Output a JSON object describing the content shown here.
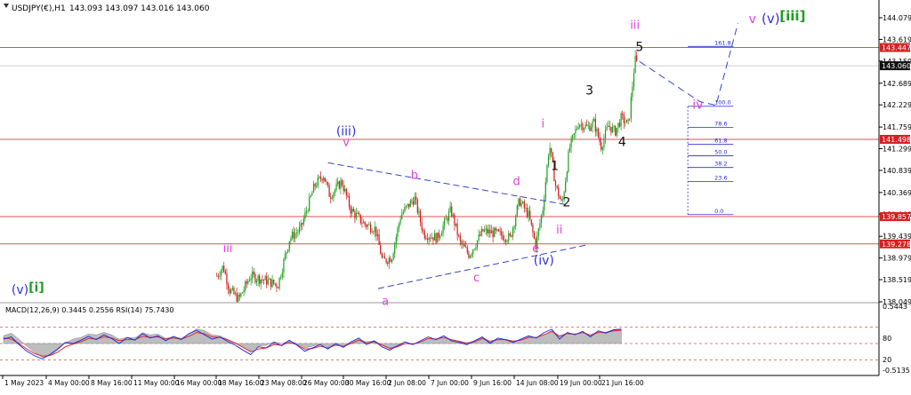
{
  "header": {
    "symbol": "USDJPY(€),H1",
    "ohlc": "143.093 143.097 143.016 143.060"
  },
  "colors": {
    "candle_up": "#1a9e1a",
    "candle_down": "#d01818",
    "level_line": "#e05050",
    "wave_magenta": "#e040e0",
    "wave_blue": "#3030e0",
    "wave_green": "#1f9f1f",
    "wave_black": "#111111",
    "trend_line": "#3344cc",
    "fib": "#2a2ad0",
    "price_tag": "#d62020",
    "current_tag": "#111111",
    "macd_hist": "#bdbdbd",
    "macd_signal": "#e03030",
    "rsi": "#2020e0",
    "indicator_level": "#e05050"
  },
  "chart_data": {
    "type": "candlestick",
    "y_axis_ticks": [
      "144.079",
      "143.619",
      "143.159",
      "142.689",
      "142.229",
      "141.759",
      "141.299",
      "140.839",
      "140.369",
      "139.909",
      "139.439",
      "138.979",
      "138.519",
      "138.049"
    ],
    "ylim": [
      138.049,
      144.079
    ],
    "x_axis_ticks": [
      "1 May 2023",
      "4 May 00:00",
      "8 May 16:00",
      "11 May 00:00",
      "16 May 00:00",
      "18 May 16:00",
      "23 May 08:00",
      "26 May 00:00",
      "30 May 16:00",
      "2 Jun 08:00",
      "7 Jun 00:00",
      "9 Jun 16:00",
      "14 Jun 08:00",
      "19 Jun 00:00",
      "21 Jun 16:00"
    ],
    "current_price": "143.060",
    "price_levels": [
      {
        "label": "143.447",
        "value": 143.447
      },
      {
        "label": "141.498",
        "value": 141.498
      },
      {
        "label": "139.857",
        "value": 139.857
      },
      {
        "label": "139.278",
        "value": 139.278
      }
    ],
    "price_path": [
      {
        "x": 0.238,
        "y": 138.6
      },
      {
        "x": 0.245,
        "y": 138.8
      },
      {
        "x": 0.252,
        "y": 138.3
      },
      {
        "x": 0.262,
        "y": 138.1
      },
      {
        "x": 0.275,
        "y": 138.6
      },
      {
        "x": 0.292,
        "y": 138.5
      },
      {
        "x": 0.305,
        "y": 138.4
      },
      {
        "x": 0.318,
        "y": 139.4
      },
      {
        "x": 0.33,
        "y": 139.6
      },
      {
        "x": 0.345,
        "y": 140.5
      },
      {
        "x": 0.355,
        "y": 140.75
      },
      {
        "x": 0.362,
        "y": 140.3
      },
      {
        "x": 0.375,
        "y": 140.6
      },
      {
        "x": 0.385,
        "y": 140.0
      },
      {
        "x": 0.4,
        "y": 139.7
      },
      {
        "x": 0.412,
        "y": 139.6
      },
      {
        "x": 0.42,
        "y": 138.9
      },
      {
        "x": 0.43,
        "y": 139.0
      },
      {
        "x": 0.44,
        "y": 139.9
      },
      {
        "x": 0.455,
        "y": 140.25
      },
      {
        "x": 0.465,
        "y": 139.5
      },
      {
        "x": 0.48,
        "y": 139.4
      },
      {
        "x": 0.495,
        "y": 140.0
      },
      {
        "x": 0.505,
        "y": 139.3
      },
      {
        "x": 0.515,
        "y": 139.05
      },
      {
        "x": 0.53,
        "y": 139.55
      },
      {
        "x": 0.545,
        "y": 139.5
      },
      {
        "x": 0.56,
        "y": 139.4
      },
      {
        "x": 0.57,
        "y": 140.2
      },
      {
        "x": 0.58,
        "y": 139.9
      },
      {
        "x": 0.588,
        "y": 139.25
      },
      {
        "x": 0.596,
        "y": 140.05
      },
      {
        "x": 0.603,
        "y": 141.4
      },
      {
        "x": 0.61,
        "y": 140.5
      },
      {
        "x": 0.617,
        "y": 140.1
      },
      {
        "x": 0.625,
        "y": 141.3
      },
      {
        "x": 0.635,
        "y": 141.85
      },
      {
        "x": 0.645,
        "y": 141.75
      },
      {
        "x": 0.652,
        "y": 141.85
      },
      {
        "x": 0.66,
        "y": 141.35
      },
      {
        "x": 0.668,
        "y": 141.8
      },
      {
        "x": 0.675,
        "y": 141.65
      },
      {
        "x": 0.682,
        "y": 141.95
      },
      {
        "x": 0.69,
        "y": 141.8
      },
      {
        "x": 0.697,
        "y": 143.2
      },
      {
        "x": 0.7,
        "y": 143.06
      }
    ],
    "wave_labels": [
      {
        "text": "(v)",
        "x": 0.022,
        "y": 138.22,
        "color": "wave_blue",
        "size": 14
      },
      {
        "text": "[i]",
        "x": 0.04,
        "y": 138.27,
        "color": "wave_green",
        "size": 14,
        "weight": "bold"
      },
      {
        "text": "iii",
        "x": 0.25,
        "y": 139.1,
        "color": "wave_magenta",
        "size": 13
      },
      {
        "text": "(iii)",
        "x": 0.38,
        "y": 141.58,
        "color": "wave_blue",
        "size": 14
      },
      {
        "text": "v",
        "x": 0.38,
        "y": 141.36,
        "color": "wave_magenta",
        "size": 13
      },
      {
        "text": "a",
        "x": 0.423,
        "y": 137.98,
        "color": "wave_magenta",
        "size": 13
      },
      {
        "text": "b",
        "x": 0.455,
        "y": 140.66,
        "color": "wave_magenta",
        "size": 13
      },
      {
        "text": "c",
        "x": 0.523,
        "y": 138.48,
        "color": "wave_magenta",
        "size": 13
      },
      {
        "text": "d",
        "x": 0.567,
        "y": 140.53,
        "color": "wave_magenta",
        "size": 13
      },
      {
        "text": "e",
        "x": 0.588,
        "y": 139.1,
        "color": "wave_magenta",
        "size": 13
      },
      {
        "text": "(iv)",
        "x": 0.597,
        "y": 138.84,
        "color": "wave_blue",
        "size": 14
      },
      {
        "text": "ii",
        "x": 0.614,
        "y": 139.5,
        "color": "wave_magenta",
        "size": 13
      },
      {
        "text": "i",
        "x": 0.596,
        "y": 141.75,
        "color": "wave_magenta",
        "size": 13
      },
      {
        "text": "1",
        "x": 0.609,
        "y": 140.85,
        "color": "wave_black",
        "size": 14
      },
      {
        "text": "2",
        "x": 0.622,
        "y": 140.07,
        "color": "wave_black",
        "size": 14
      },
      {
        "text": "3",
        "x": 0.647,
        "y": 142.45,
        "color": "wave_black",
        "size": 14
      },
      {
        "text": "4",
        "x": 0.683,
        "y": 141.36,
        "color": "wave_black",
        "size": 14
      },
      {
        "text": "5",
        "x": 0.702,
        "y": 143.37,
        "color": "wave_black",
        "size": 14
      },
      {
        "text": "iii",
        "x": 0.697,
        "y": 143.84,
        "color": "wave_magenta",
        "size": 13
      },
      {
        "text": "iv",
        "x": 0.766,
        "y": 142.15,
        "color": "wave_magenta",
        "size": 14
      },
      {
        "text": "v",
        "x": 0.826,
        "y": 143.97,
        "color": "wave_magenta",
        "size": 14
      },
      {
        "text": "(v)",
        "x": 0.846,
        "y": 143.97,
        "color": "wave_blue",
        "size": 15
      },
      {
        "text": "[iii]",
        "x": 0.87,
        "y": 144.02,
        "color": "wave_green",
        "size": 15,
        "weight": "bold"
      }
    ],
    "trend_lines": [
      {
        "x1": 0.36,
        "y1": 141.0,
        "x2": 0.625,
        "y2": 140.1
      },
      {
        "x1": 0.415,
        "y1": 138.33,
        "x2": 0.645,
        "y2": 139.26
      }
    ],
    "projection_path": [
      {
        "x": 0.702,
        "y": 143.15
      },
      {
        "x": 0.768,
        "y": 142.3
      },
      {
        "x": 0.786,
        "y": 142.22
      },
      {
        "x": 0.81,
        "y": 143.96
      }
    ],
    "fibonacci": {
      "x_left": 0.755,
      "x_right": 0.805,
      "levels": [
        {
          "label": "161.8",
          "value": 143.47
        },
        {
          "label": "100.0",
          "value": 142.2
        },
        {
          "label": "78.6",
          "value": 141.75
        },
        {
          "label": "61.8",
          "value": 141.39
        },
        {
          "label": "50.0",
          "value": 141.15
        },
        {
          "label": "38.2",
          "value": 140.9
        },
        {
          "label": "23.6",
          "value": 140.6
        },
        {
          "label": "0.0",
          "value": 139.9
        }
      ]
    },
    "indicator": {
      "title": "MACD(12,26,9) 0.3445 0.2556 RSI(14) 75.7430",
      "y_ticks": [
        "0.5443",
        "80",
        "20",
        "-0.5135"
      ],
      "levels": [
        80,
        50,
        20
      ],
      "rsi": [
        58,
        62,
        48,
        36,
        28,
        22,
        30,
        40,
        52,
        50,
        56,
        63,
        57,
        66,
        59,
        50,
        61,
        56,
        68,
        60,
        64,
        55,
        63,
        57,
        68,
        74,
        66,
        58,
        62,
        54,
        47,
        38,
        30,
        44,
        42,
        52,
        46,
        56,
        47,
        36,
        42,
        48,
        40,
        50,
        43,
        53,
        60,
        48,
        55,
        44,
        38,
        46,
        53,
        48,
        55,
        62,
        57,
        64,
        55,
        52,
        48,
        55,
        62,
        50,
        60,
        57,
        52,
        58,
        64,
        60,
        70,
        76,
        58,
        70,
        66,
        72,
        62,
        73,
        69,
        75,
        76
      ],
      "signal": [
        60,
        58,
        50,
        40,
        32,
        27,
        28,
        34,
        44,
        49,
        53,
        59,
        58,
        62,
        60,
        55,
        57,
        57,
        63,
        61,
        62,
        58,
        60,
        58,
        63,
        70,
        68,
        62,
        61,
        57,
        51,
        43,
        35,
        40,
        42,
        48,
        47,
        52,
        48,
        40,
        41,
        45,
        42,
        47,
        45,
        50,
        56,
        51,
        53,
        47,
        41,
        44,
        50,
        49,
        53,
        59,
        58,
        61,
        57,
        54,
        50,
        53,
        59,
        53,
        57,
        57,
        54,
        56,
        61,
        61,
        66,
        72,
        63,
        68,
        67,
        70,
        65,
        70,
        70,
        73,
        74
      ],
      "histogram": [
        0.18,
        0.24,
        0.1,
        -0.06,
        -0.2,
        -0.32,
        -0.28,
        -0.16,
        0.02,
        0.1,
        0.14,
        0.22,
        0.2,
        0.26,
        0.2,
        0.1,
        0.14,
        0.13,
        0.25,
        0.2,
        0.22,
        0.12,
        0.16,
        0.12,
        0.22,
        0.34,
        0.3,
        0.2,
        0.18,
        0.1,
        0.02,
        -0.08,
        -0.18,
        -0.06,
        -0.04,
        0.04,
        0.0,
        0.06,
        0.0,
        -0.1,
        -0.06,
        -0.02,
        -0.08,
        -0.02,
        -0.06,
        0.02,
        0.1,
        0.04,
        0.06,
        -0.02,
        -0.1,
        -0.06,
        0.0,
        -0.02,
        0.04,
        0.12,
        0.1,
        0.14,
        0.08,
        0.06,
        0.02,
        0.06,
        0.14,
        0.06,
        0.1,
        0.1,
        0.06,
        0.08,
        0.16,
        0.14,
        0.2,
        0.3,
        0.18,
        0.24,
        0.22,
        0.26,
        0.2,
        0.28,
        0.26,
        0.32,
        0.34
      ]
    }
  }
}
